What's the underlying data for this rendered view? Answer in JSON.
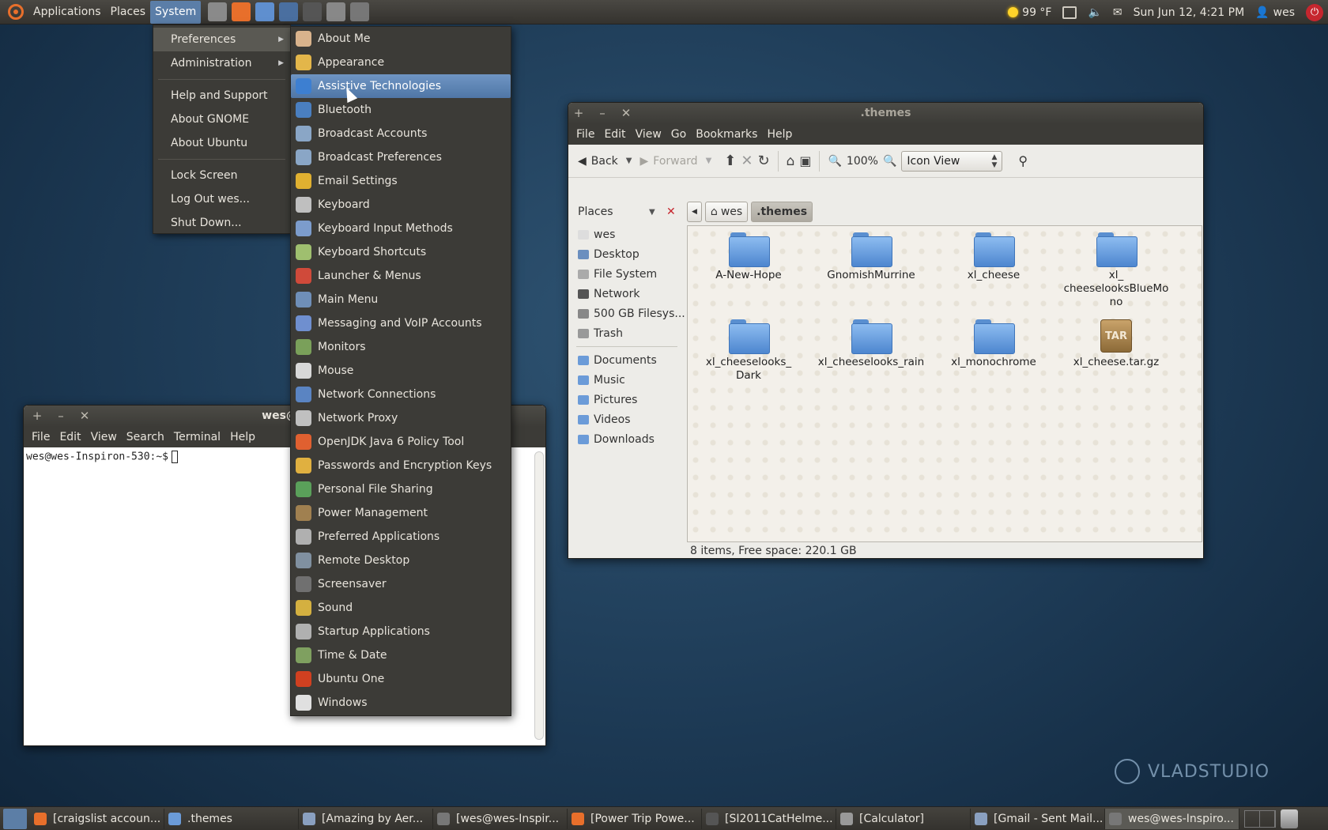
{
  "top_panel": {
    "menus": [
      "Applications",
      "Places",
      "System"
    ],
    "active_menu": "System",
    "launchers": [
      "calculator-icon",
      "firefox-icon",
      "monitor-icon",
      "network-icon",
      "terminal-icon",
      "tools-icon",
      "camera-icon"
    ],
    "weather": "99 °F",
    "datetime": "Sun Jun 12,  4:21 PM",
    "user": "wes"
  },
  "system_menu": {
    "items": [
      {
        "label": "Preferences",
        "submenu": true,
        "highlight": true
      },
      {
        "label": "Administration",
        "submenu": true
      },
      {
        "sep": true
      },
      {
        "label": "Help and Support"
      },
      {
        "label": "About GNOME"
      },
      {
        "label": "About Ubuntu"
      },
      {
        "sep": true
      },
      {
        "label": "Lock Screen"
      },
      {
        "label": "Log Out wes..."
      },
      {
        "label": "Shut Down..."
      }
    ]
  },
  "preferences_menu": {
    "items": [
      {
        "label": "About Me",
        "color": "#d9b38c"
      },
      {
        "label": "Appearance",
        "color": "#e3b64a"
      },
      {
        "label": "Assistive Technologies",
        "color": "#3d7fd1",
        "highlight": true
      },
      {
        "label": "Bluetooth",
        "color": "#4a7fc0"
      },
      {
        "label": "Broadcast Accounts",
        "color": "#8aa6c6"
      },
      {
        "label": "Broadcast Preferences",
        "color": "#8aa6c6"
      },
      {
        "label": "Email Settings",
        "color": "#e0b030"
      },
      {
        "label": "Keyboard",
        "color": "#bfbfbf"
      },
      {
        "label": "Keyboard Input Methods",
        "color": "#7c9ccc"
      },
      {
        "label": "Keyboard Shortcuts",
        "color": "#9fbf6f"
      },
      {
        "label": "Launcher & Menus",
        "color": "#d04a3a"
      },
      {
        "label": "Main Menu",
        "color": "#6f8fb8"
      },
      {
        "label": "Messaging and VoIP Accounts",
        "color": "#6f8fcf"
      },
      {
        "label": "Monitors",
        "color": "#7aa05a"
      },
      {
        "label": "Mouse",
        "color": "#d8d8d8"
      },
      {
        "label": "Network Connections",
        "color": "#5a84c2"
      },
      {
        "label": "Network Proxy",
        "color": "#c0c0c0"
      },
      {
        "label": "OpenJDK Java 6 Policy Tool",
        "color": "#e06030"
      },
      {
        "label": "Passwords and Encryption Keys",
        "color": "#e0b040"
      },
      {
        "label": "Personal File Sharing",
        "color": "#5aa05a"
      },
      {
        "label": "Power Management",
        "color": "#a08050"
      },
      {
        "label": "Preferred Applications",
        "color": "#b0b0b0"
      },
      {
        "label": "Remote Desktop",
        "color": "#8090a0"
      },
      {
        "label": "Screensaver",
        "color": "#707070"
      },
      {
        "label": "Sound",
        "color": "#d4b040"
      },
      {
        "label": "Startup Applications",
        "color": "#b0b0b0"
      },
      {
        "label": "Time & Date",
        "color": "#7fa060"
      },
      {
        "label": "Ubuntu One",
        "color": "#d04020"
      },
      {
        "label": "Windows",
        "color": "#e0e0e0"
      }
    ]
  },
  "file_manager": {
    "title": ".themes",
    "menus": [
      "File",
      "Edit",
      "View",
      "Go",
      "Bookmarks",
      "Help"
    ],
    "toolbar": {
      "back": "Back",
      "forward": "Forward",
      "zoom": "100%",
      "view_mode": "Icon View"
    },
    "sidebar": {
      "header": "Places",
      "places": [
        "wes",
        "Desktop",
        "File System",
        "Network",
        "500 GB Filesys...",
        "Trash"
      ],
      "bookmarks": [
        "Documents",
        "Music",
        "Pictures",
        "Videos",
        "Downloads"
      ]
    },
    "path": [
      "wes",
      ".themes"
    ],
    "items": [
      {
        "name": "A-New-Hope",
        "kind": "folder"
      },
      {
        "name": "GnomishMurrine",
        "kind": "folder"
      },
      {
        "name": "xl_cheese",
        "kind": "folder"
      },
      {
        "name": "xl_\ncheeselooksBlueMo\nno",
        "kind": "folder"
      },
      {
        "name": "xl_cheeselooks_\nDark",
        "kind": "folder"
      },
      {
        "name": "xl_cheeselooks_rain",
        "kind": "folder"
      },
      {
        "name": "xl_monochrome",
        "kind": "folder"
      },
      {
        "name": "xl_cheese.tar.gz",
        "kind": "archive",
        "badge": "TAR"
      }
    ],
    "status": "8 items, Free space: 220.1 GB"
  },
  "terminal": {
    "title": "wes@w",
    "menus": [
      "File",
      "Edit",
      "View",
      "Search",
      "Terminal",
      "Help"
    ],
    "prompt": "wes@wes-Inspiron-530:~$"
  },
  "taskbar": {
    "tasks": [
      {
        "label": "[craigslist accoun...",
        "color": "#e86f2b"
      },
      {
        "label": ".themes",
        "color": "#6b9bd8"
      },
      {
        "label": "[Amazing by Aer...",
        "color": "#8aa0c0"
      },
      {
        "label": "[wes@wes-Inspir...",
        "color": "#777"
      },
      {
        "label": "[Power Trip Powe...",
        "color": "#e86f2b"
      },
      {
        "label": "[SI2011CatHelme...",
        "color": "#555"
      },
      {
        "label": "[Calculator]",
        "color": "#999"
      },
      {
        "label": "[Gmail - Sent Mail...",
        "color": "#8aa0c0"
      },
      {
        "label": "wes@wes-Inspiro...",
        "color": "#777",
        "active": true
      }
    ]
  },
  "watermark": "VLADSTUDIO"
}
